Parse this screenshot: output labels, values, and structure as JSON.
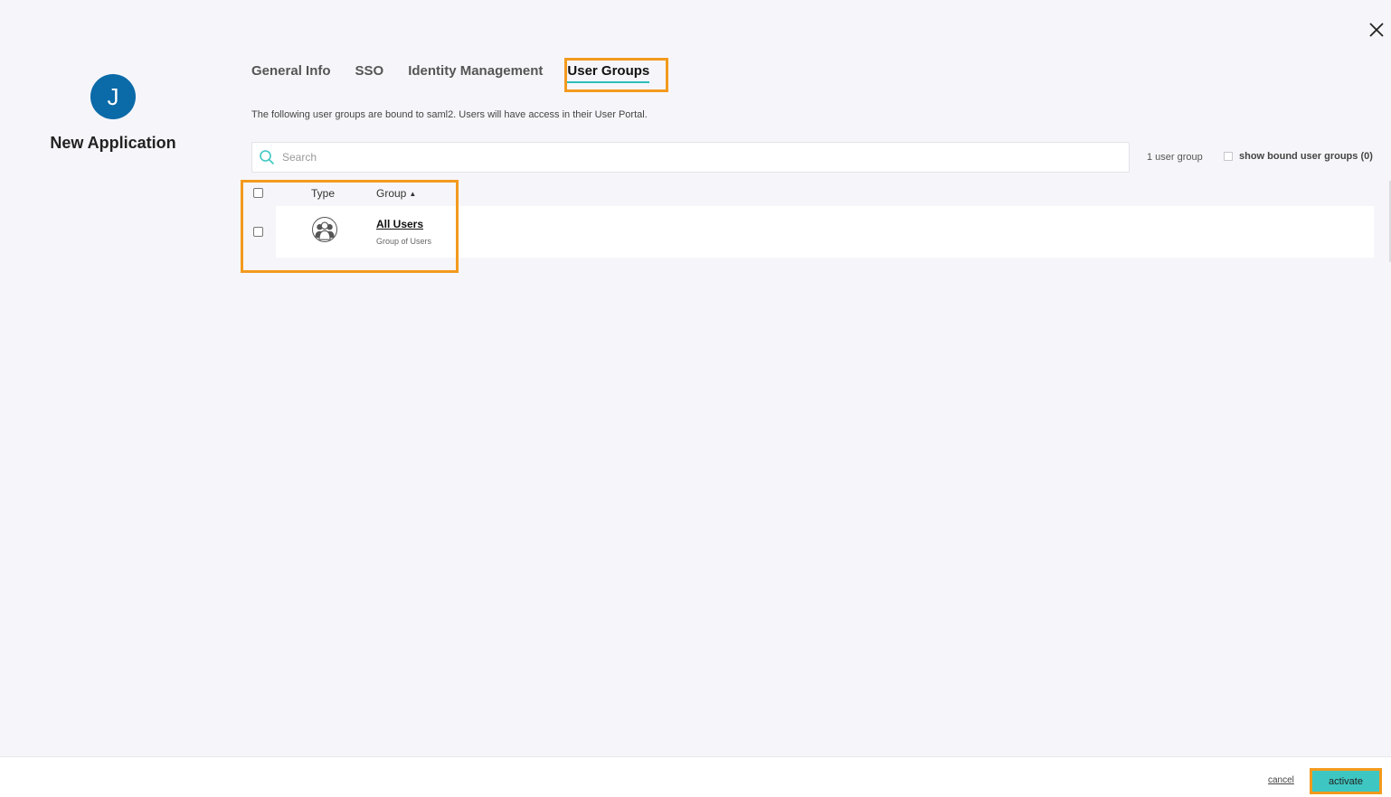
{
  "app": {
    "avatar_letter": "J",
    "title": "New Application"
  },
  "tabs": [
    {
      "label": "General Info",
      "active": false
    },
    {
      "label": "SSO",
      "active": false
    },
    {
      "label": "Identity Management",
      "active": false
    },
    {
      "label": "User Groups",
      "active": true
    }
  ],
  "description": "The following user groups are bound to saml2. Users will have access in their User Portal.",
  "search": {
    "placeholder": "Search",
    "value": ""
  },
  "group_count": "1 user group",
  "show_bound_label": "show bound user groups (0)",
  "table": {
    "columns": {
      "type": "Type",
      "group": "Group"
    },
    "sort_indicator": "▲",
    "rows": [
      {
        "name": "All Users",
        "subtitle": "Group of Users",
        "icon": "user-group-icon"
      }
    ]
  },
  "footer": {
    "cancel_label": "cancel",
    "activate_label": "activate"
  },
  "colors": {
    "accent": "#3ec7c2",
    "avatar": "#0b6aa8",
    "highlight": "#f39a1e",
    "background": "#f6f6fa"
  }
}
